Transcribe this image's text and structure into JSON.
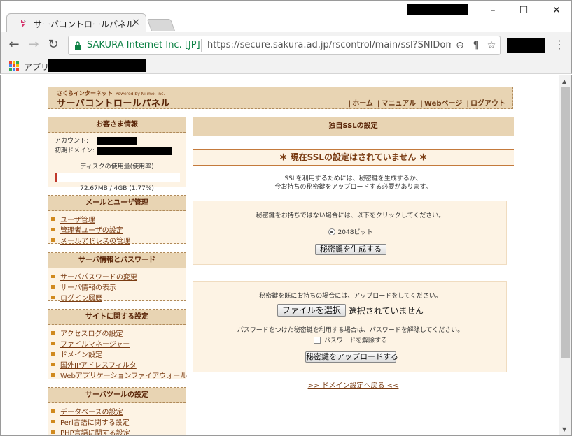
{
  "browser": {
    "tab_title": "サーバコントロールパネル",
    "tab_close": "×",
    "window_controls": {
      "minimize": "–",
      "maximize": "☐",
      "close": "✕"
    },
    "site_identity": "SAKURA Internet Inc. [JP]",
    "url": "https://secure.sakura.ad.jp/rscontrol/main/ssl?SNIDomai",
    "bookmarks_apps_label": "アプリ"
  },
  "header": {
    "brand_top": "さくらインターネット",
    "brand_powered": "Powered by Nijimo, Inc.",
    "brand_main": "サーバコントロールパネル",
    "links": [
      "ホーム",
      "マニュアル",
      "Webページ",
      "ログアウト"
    ]
  },
  "account": {
    "title": "お客さま情報",
    "account_label": "アカウント:",
    "domain_label": "初期ドメイン:",
    "disk_label": "ディスクの使用量(使用率)",
    "disk_usage": "72.67MB / 4GB (1.77%)",
    "disk_fraction": 0.0177
  },
  "sidebar": {
    "sections": [
      {
        "title": "メールとユーザ管理",
        "items": [
          "ユーザ管理",
          "管理者ユーザの設定",
          "メールアドレスの管理"
        ]
      },
      {
        "title": "サーバ情報とパスワード",
        "items": [
          "サーバパスワードの変更",
          "サーバ情報の表示",
          "ログイン履歴"
        ]
      },
      {
        "title": "サイトに関する設定",
        "items": [
          "アクセスログの設定",
          "ファイルマネージャー",
          "ドメイン設定",
          "国外IPアドレスフィルタ",
          "Webアプリケーションファイアウォール"
        ]
      },
      {
        "title": "サーバツールの設定",
        "items": [
          "データベースの設定",
          "Perl言語に関する設定",
          "PHP言語に関する設定"
        ]
      }
    ]
  },
  "main": {
    "page_title": "独自SSLの設定",
    "status": "＊ 現在SSLの設定はされていません ＊",
    "intro_line1": "SSLを利用するためには、秘密鍵を生成するか、",
    "intro_line2": "今お持ちの秘密鍵をアップロードする必要があります。",
    "generate": {
      "text": "秘密鍵をお持ちではない場合には、以下をクリックしてください。",
      "radio_label": "2048ビット",
      "button": "秘密鍵を生成する"
    },
    "upload": {
      "text": "秘密鍵を既にお持ちの場合には、アップロードをしてください。",
      "file_button": "ファイルを選択",
      "file_status": "選択されていません",
      "password_text": "パスワードをつけた秘密鍵を利用する場合は、パスワードを解除してください。",
      "checkbox_label": "パスワードを解除する",
      "button": "秘密鍵をアップロードする"
    },
    "back_link": ">> ドメイン設定へ戻る <<"
  }
}
